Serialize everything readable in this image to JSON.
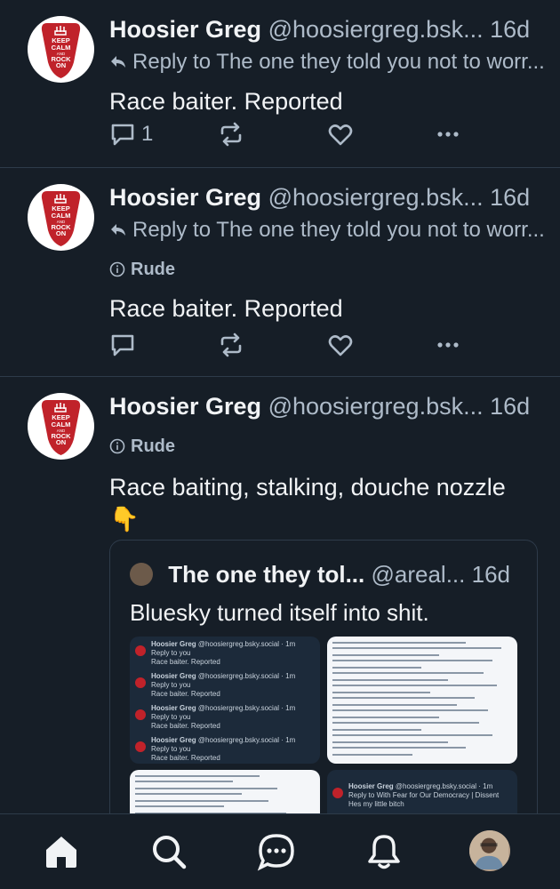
{
  "posts": [
    {
      "author_name": "Hoosier Greg",
      "author_handle": "@hoosiergreg.bsk...",
      "time": "16d",
      "reply_to": "Reply to The one they told you not to worr...",
      "label": "",
      "text": "Race baiter. Reported",
      "reply_count": "1"
    },
    {
      "author_name": "Hoosier Greg",
      "author_handle": "@hoosiergreg.bsk...",
      "time": "16d",
      "reply_to": "Reply to The one they told you not to worr...",
      "label": "Rude",
      "text": "Race baiter. Reported",
      "reply_count": ""
    },
    {
      "author_name": "Hoosier Greg",
      "author_handle": "@hoosiergreg.bsk...",
      "time": "16d",
      "reply_to": "",
      "label": "Rude",
      "text": "Race baiting, stalking, douche nozzle",
      "emoji": "👇",
      "reply_count": ""
    }
  ],
  "avatar_text": [
    "KEEP",
    "CALM",
    "AND",
    "ROCK",
    "ON"
  ],
  "quote": {
    "author_name": "The one they tol...",
    "author_handle": "@areal...",
    "time": "16d",
    "text": "Bluesky turned itself into shit.",
    "img_rows": [
      {
        "name": "Hoosier Greg",
        "handle": "@hoosiergreg.bsky.social · 1m",
        "reply": "Reply to you",
        "text": "Race baiter. Reported"
      },
      {
        "name": "Hoosier Greg",
        "handle": "@hoosiergreg.bsky.social · 1m",
        "reply": "Reply to you",
        "text": "Race baiter. Reported"
      },
      {
        "name": "Hoosier Greg",
        "handle": "@hoosiergreg.bsky.social · 1m",
        "reply": "Reply to you",
        "text": "Race baiter. Reported"
      },
      {
        "name": "Hoosier Greg",
        "handle": "@hoosiergreg.bsky.social · 1m",
        "reply": "Reply to you",
        "text": "Race baiter. Reported"
      }
    ],
    "img4": {
      "name": "Hoosier Greg",
      "handle": "@hoosiergreg.bsky.social · 1m",
      "reply": "Reply to With Fear for Our Democracy | Dissent",
      "text": "Hes my little bitch"
    }
  },
  "colors": {
    "background": "#161e27",
    "muted": "#aebbc9",
    "divider": "#2e3b4a",
    "avatar_red": "#c0222a"
  },
  "tabs": [
    "home-icon",
    "search-icon",
    "chat-icon",
    "bell-icon",
    "profile-avatar"
  ]
}
